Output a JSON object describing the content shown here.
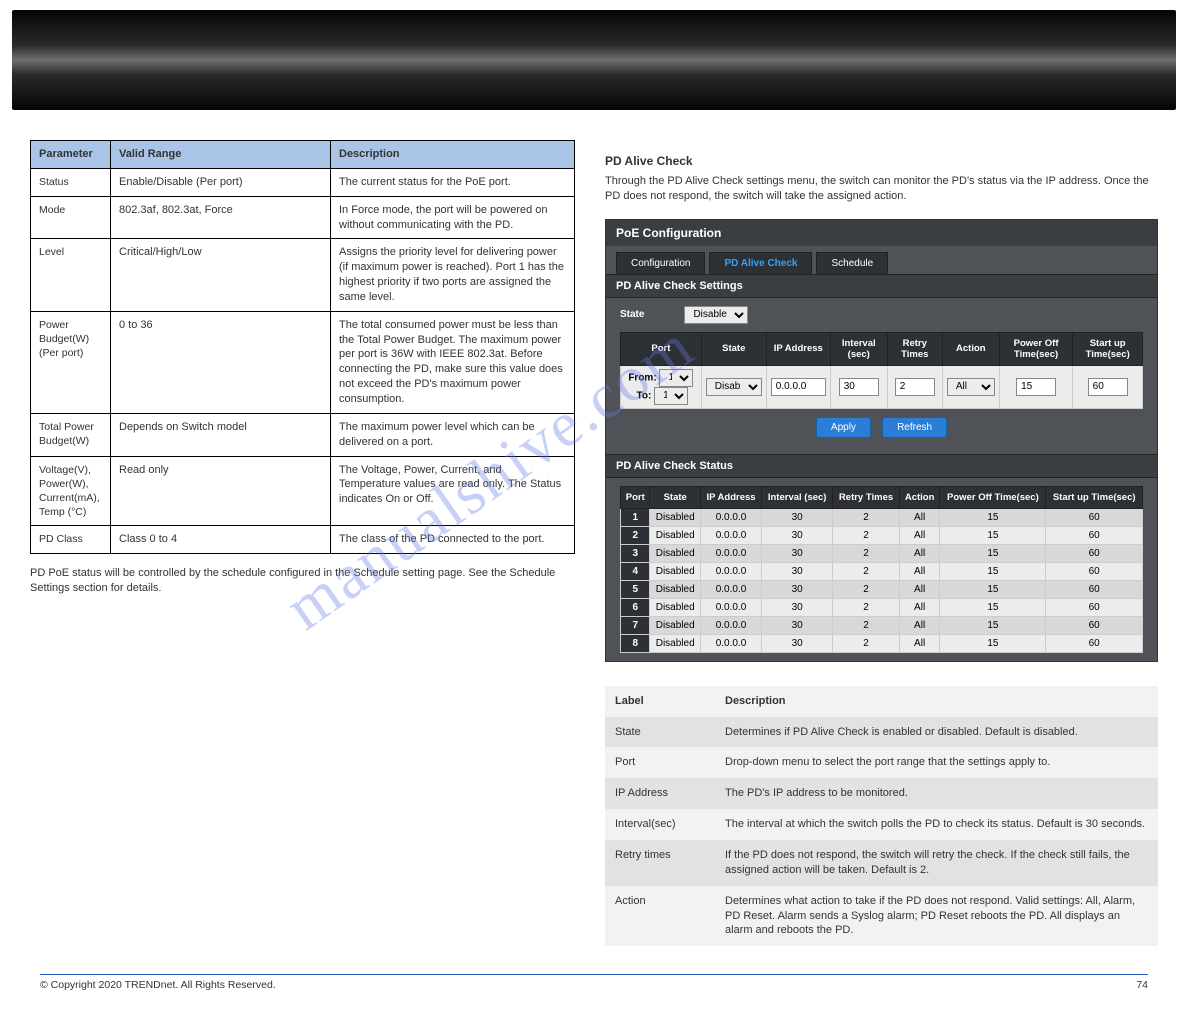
{
  "banner": {},
  "params_table": {
    "headers": [
      "Parameter",
      "Valid Range",
      "Description"
    ],
    "rows": [
      {
        "name": "Status",
        "range": "Enable/Disable (Per port)",
        "desc": "The current status for the PoE port."
      },
      {
        "name": "Mode",
        "range": "802.3af, 802.3at, Force",
        "desc": "In Force mode, the port will be powered on without communicating with the PD."
      },
      {
        "name": "Level",
        "range": "Critical/High/Low",
        "desc": "Assigns the priority level for delivering power (if maximum power is reached). Port 1 has the highest priority if two ports are assigned the same level."
      },
      {
        "name": "Power Budget(W)\n(Per port)",
        "range": "0 to 36",
        "desc": "The total consumed power must be less than the Total Power Budget. The maximum power per port is 36W with IEEE 802.3at. Before connecting the PD, make sure this value does not exceed the PD's maximum power consumption."
      },
      {
        "name": "Total Power Budget(W)",
        "range": "Depends on Switch model",
        "desc": "The maximum power level which can be delivered on a port."
      },
      {
        "name": "Voltage(V), Power(W), Current(mA), Temp (°C)",
        "range": "Read only",
        "desc": "The Voltage, Power, Current, and Temperature values are read only. The Status indicates On or Off."
      },
      {
        "name": "PD Class",
        "range": "Class 0 to 4",
        "desc": "The class of the PD connected to the port."
      }
    ]
  },
  "left_note": "PD PoE status will be controlled by the schedule configured in the Schedule setting page. See the Schedule Settings section for details.",
  "right_note": "Through the PD Alive Check settings menu, the switch can monitor the PD's status via the IP address. Once the PD does not respond, the switch will take the assigned action.",
  "pd_heading": "PD Alive Check",
  "ui": {
    "title": "PoE Configuration",
    "tabs": [
      "Configuration",
      "PD Alive Check",
      "Schedule"
    ],
    "sect1": "PD Alive Check Settings",
    "state_label": "State",
    "state_value": "Disable",
    "cols": [
      "Port",
      "State",
      "IP Address",
      "Interval (sec)",
      "Retry Times",
      "Action",
      "Power Off Time(sec)",
      "Start up Time(sec)"
    ],
    "input_row": {
      "from": "1",
      "to": "1",
      "state": "Disable",
      "ip": "0.0.0.0",
      "interval": "30",
      "retry": "2",
      "action": "All",
      "poff": "15",
      "sup": "60"
    },
    "from_label": "From:",
    "to_label": "To:",
    "btn_apply": "Apply",
    "btn_refresh": "Refresh",
    "sect2": "PD Alive Check Status",
    "status_cols": [
      "Port",
      "State",
      "IP Address",
      "Interval (sec)",
      "Retry Times",
      "Action",
      "Power Off Time(sec)",
      "Start up Time(sec)"
    ],
    "status_rows": [
      {
        "p": "1",
        "s": "Disabled",
        "ip": "0.0.0.0",
        "iv": "30",
        "r": "2",
        "a": "All",
        "po": "15",
        "su": "60"
      },
      {
        "p": "2",
        "s": "Disabled",
        "ip": "0.0.0.0",
        "iv": "30",
        "r": "2",
        "a": "All",
        "po": "15",
        "su": "60"
      },
      {
        "p": "3",
        "s": "Disabled",
        "ip": "0.0.0.0",
        "iv": "30",
        "r": "2",
        "a": "All",
        "po": "15",
        "su": "60"
      },
      {
        "p": "4",
        "s": "Disabled",
        "ip": "0.0.0.0",
        "iv": "30",
        "r": "2",
        "a": "All",
        "po": "15",
        "su": "60"
      },
      {
        "p": "5",
        "s": "Disabled",
        "ip": "0.0.0.0",
        "iv": "30",
        "r": "2",
        "a": "All",
        "po": "15",
        "su": "60"
      },
      {
        "p": "6",
        "s": "Disabled",
        "ip": "0.0.0.0",
        "iv": "30",
        "r": "2",
        "a": "All",
        "po": "15",
        "su": "60"
      },
      {
        "p": "7",
        "s": "Disabled",
        "ip": "0.0.0.0",
        "iv": "30",
        "r": "2",
        "a": "All",
        "po": "15",
        "su": "60"
      },
      {
        "p": "8",
        "s": "Disabled",
        "ip": "0.0.0.0",
        "iv": "30",
        "r": "2",
        "a": "All",
        "po": "15",
        "su": "60"
      }
    ]
  },
  "info_table": {
    "headers": [
      "Label",
      "Description"
    ],
    "rows": [
      {
        "label": "State",
        "desc": "Determines if PD Alive Check is enabled or disabled. Default is disabled."
      },
      {
        "label": "Port",
        "desc": "Drop-down menu to select the port range that the settings apply to."
      },
      {
        "label": "IP Address",
        "desc": "The PD's IP address to be monitored."
      },
      {
        "label": "Interval(sec)",
        "desc": "The interval at which the switch polls the PD to check its status. Default is 30 seconds."
      },
      {
        "label": "Retry times",
        "desc": "If the PD does not respond, the switch will retry the check. If the check still fails, the assigned action will be taken. Default is 2."
      },
      {
        "label": "Action",
        "desc": "Determines what action to take if the PD does not respond. Valid settings: All, Alarm, PD Reset. Alarm sends a Syslog alarm; PD Reset reboots the PD. All displays an alarm and reboots the PD."
      }
    ]
  },
  "footer": {
    "copyright": "© Copyright 2020 TRENDnet. All Rights Reserved.",
    "page": "74"
  },
  "watermark": "manualshive.com"
}
